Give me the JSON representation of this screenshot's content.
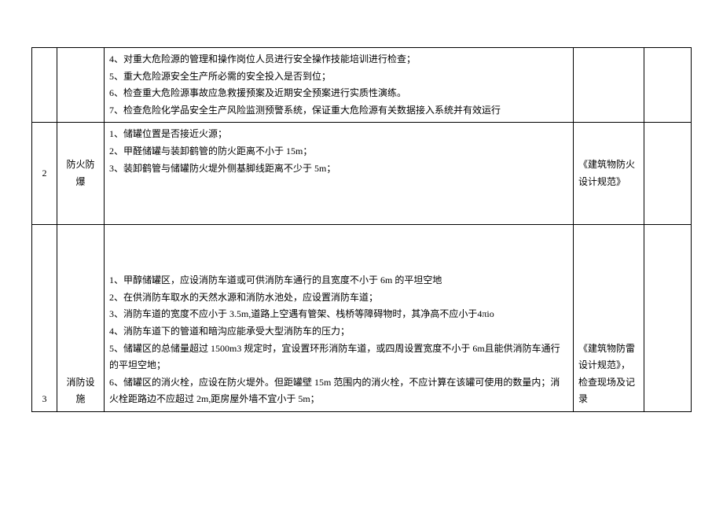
{
  "rows": [
    {
      "num": "",
      "name": "",
      "content": "4、对重大危险源的管理和操作岗位人员进行安全操作技能培训进行检查；\n5、重大危险源安全生产所必需的安全投入是否到位；\n6、检查重大危险源事故应急救援预案及近期安全预案进行实质性演练。\n7、检查危险化学品安全生产风险监测预警系统，保证重大危险源有关数据接入系统并有效运行",
      "ref": ""
    },
    {
      "num": "2",
      "name": "防火防爆",
      "content": "1、储罐位置是否接近火源；\n2、甲醛储罐与装卸鹤管的防火距离不小于 15m；\n3、装卸鹤管与储罐防火堤外侧基脚线距离不少于 5m；",
      "ref": "《建筑物防火设计规范》"
    },
    {
      "num": "3",
      "name": "消防设施",
      "content": "1、甲醇储罐区，应设消防车道或可供消防车通行的且宽度不小于 6m 的平坦空地\n2、在供消防车取水的天然水源和消防水池处，应设置消防车道；\n3、消防车道的宽度不应小于 3.5m,道路上空遇有管架、栈桥等障碍物时，其净高不应小于4πio\n4、消防车道下的管道和暗沟应能承受大型消防车的压力；\n5、储罐区的总储量超过 1500m3 规定时，宜设置环形消防车道，或四周设置宽度不小于 6m且能供消防车通行的平坦空地；\n6、储罐区的消火栓，应设在防火堤外。但距罐壁 15m 范围内的消火栓，不应计算在该罐可使用的数量内；消火栓距路边不应超过 2m,距房屋外墙不宜小于 5m；",
      "ref": "《建筑物防雷设计规范》，检查现场及记录"
    }
  ]
}
